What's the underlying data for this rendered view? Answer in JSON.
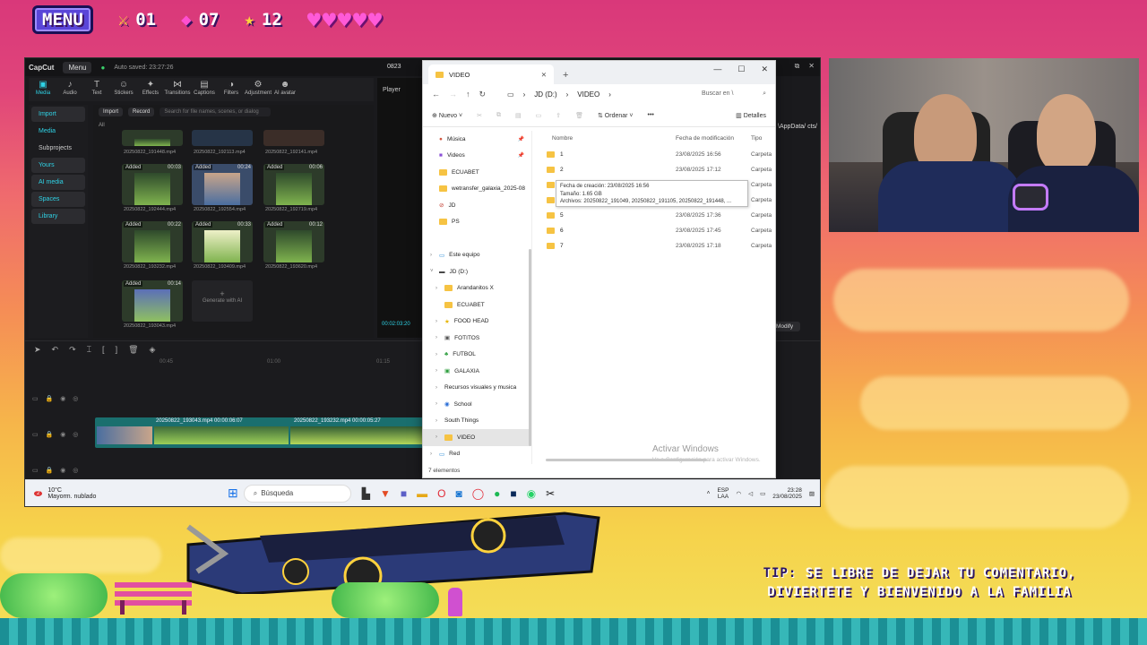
{
  "hud": {
    "menu_label": "MENU",
    "sword_count": "01",
    "gem_count": "07",
    "star_count": "12",
    "hearts": 5
  },
  "capcut": {
    "brand": "CapCut",
    "menu": "Menu",
    "autosave": "Auto saved: 23:27:26",
    "project_title": "0823",
    "tools": [
      "Media",
      "Audio",
      "Text",
      "Stickers",
      "Effects",
      "Transitions",
      "Captions",
      "Filters",
      "Adjustment",
      "AI avatar"
    ],
    "sidebar": [
      "Import",
      "Media",
      "Subprojects",
      "Yours",
      "AI media",
      "Spaces",
      "Library"
    ],
    "import_btn": "Import",
    "record_btn": "Record",
    "search_placeholder": "Search for file names, scenes, or dialog",
    "all_label": "All",
    "thumbs": [
      {
        "name": "20250822_191448.mp4",
        "dur": "",
        "added": ""
      },
      {
        "name": "20250822_192113.mp4",
        "dur": "",
        "added": ""
      },
      {
        "name": "20250822_192141.mp4",
        "dur": "",
        "added": ""
      },
      {
        "name": "20250822_192444.mp4",
        "dur": "00:03",
        "added": "Added"
      },
      {
        "name": "20250822_192554.mp4",
        "dur": "00:24",
        "added": "Added"
      },
      {
        "name": "20250822_192719.mp4",
        "dur": "00:06",
        "added": "Added"
      },
      {
        "name": "20250822_193232.mp4",
        "dur": "00:22",
        "added": "Added"
      },
      {
        "name": "20250822_193409.mp4",
        "dur": "00:33",
        "added": "Added"
      },
      {
        "name": "20250822_193620.mp4",
        "dur": "00:12",
        "added": "Added"
      },
      {
        "name": "20250822_193043.mp4",
        "dur": "00:14",
        "added": "Added"
      }
    ],
    "generate": "Generate with AI",
    "player": "Player",
    "timecode": "00:02:03:20",
    "modify": "Modify",
    "ruler": [
      "00:45",
      "01:00",
      "01:15"
    ],
    "clip1": "20250822_193043.mp4   00:00:06:07",
    "clip2": "20250822_193232.mp4   00:00:05:27",
    "path_fragment": "\\AppData/ cts/"
  },
  "explorer": {
    "tab": "VIDEO",
    "crumb_drive": "JD (D:)",
    "crumb_folder": "VIDEO",
    "search": "Buscar en \\",
    "new_btn": "Nuevo",
    "sort_btn": "Ordenar",
    "details_btn": "Detalles",
    "nav": [
      {
        "label": "Música",
        "pin": true,
        "indent": false
      },
      {
        "label": "Videos",
        "pin": true,
        "indent": false
      },
      {
        "label": "ECUABET",
        "pin": false,
        "indent": false
      },
      {
        "label": "wetransfer_galaxia_2025-08",
        "pin": false,
        "indent": false
      },
      {
        "label": "JD",
        "pin": false,
        "indent": false
      },
      {
        "label": "PS",
        "pin": false,
        "indent": false
      },
      {
        "label": "",
        "pin": false,
        "indent": false
      },
      {
        "label": "Este equipo",
        "pin": false,
        "indent": false
      },
      {
        "label": "JD (D:)",
        "pin": false,
        "indent": false
      },
      {
        "label": "Arandanitos X",
        "pin": false,
        "indent": true
      },
      {
        "label": "ECUABET",
        "pin": false,
        "indent": true
      },
      {
        "label": "FOOD HEAD",
        "pin": false,
        "indent": true
      },
      {
        "label": "FOTITOS",
        "pin": false,
        "indent": true
      },
      {
        "label": "FUTBOL",
        "pin": false,
        "indent": true
      },
      {
        "label": "GALAXIA",
        "pin": false,
        "indent": true
      },
      {
        "label": "Recursos visuales y musica",
        "pin": false,
        "indent": true
      },
      {
        "label": "School",
        "pin": false,
        "indent": true
      },
      {
        "label": "South Things",
        "pin": false,
        "indent": true
      },
      {
        "label": "VIDEO",
        "pin": false,
        "indent": true
      },
      {
        "label": "Red",
        "pin": false,
        "indent": false
      }
    ],
    "col_name": "Nombre",
    "col_date": "Fecha de modificación",
    "col_type": "Tipo",
    "rows": [
      {
        "name": "1",
        "date": "23/08/2025 16:56",
        "type": "Carpeta"
      },
      {
        "name": "2",
        "date": "23/08/2025 17:12",
        "type": "Carpeta"
      },
      {
        "name": "3",
        "date": "",
        "type": "Carpeta"
      },
      {
        "name": "4",
        "date": "",
        "type": "Carpeta"
      },
      {
        "name": "5",
        "date": "23/08/2025 17:36",
        "type": "Carpeta"
      },
      {
        "name": "6",
        "date": "23/08/2025 17:45",
        "type": "Carpeta"
      },
      {
        "name": "7",
        "date": "23/08/2025 17:18",
        "type": "Carpeta"
      }
    ],
    "tooltip": {
      "created": "Fecha de creación: 23/08/2025 16:56",
      "size": "Tamaño: 1.65 GB",
      "files": "Archivos: 20250822_191049, 20250822_191105, 20250822_191448, ..."
    },
    "status": "7 elementos",
    "activate1": "Activar Windows",
    "activate2": "Ve a Configuración para activar Windows."
  },
  "taskbar": {
    "temp": "10°C",
    "weather": "Mayorm. nublado",
    "badge": "2",
    "search": "Búsqueda",
    "lang1": "ESP",
    "lang2": "LAA",
    "time": "23:28",
    "date": "23/08/2025"
  },
  "overlay": {
    "tip_label": "TIP:",
    "tip_line1": "SE LIBRE DE DEJAR TU COMENTARIO,",
    "tip_line2": "DIVIERTETE Y BIENVENIDO A LA FAMILIA"
  }
}
